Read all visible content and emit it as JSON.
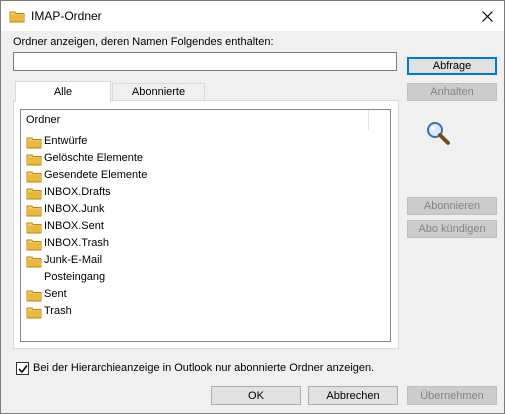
{
  "window": {
    "title": "IMAP-Ordner"
  },
  "filter": {
    "label": "Ordner anzeigen, deren Namen Folgendes enthalten:",
    "value": ""
  },
  "tabs": [
    {
      "label": "Alle",
      "active": true
    },
    {
      "label": "Abonnierte",
      "active": false
    }
  ],
  "list": {
    "header": "Ordner",
    "items": [
      {
        "label": "Entwürfe",
        "icon": "folder-icon"
      },
      {
        "label": "Gelöschte Elemente",
        "icon": "folder-icon"
      },
      {
        "label": "Gesendete Elemente",
        "icon": "folder-icon"
      },
      {
        "label": "INBOX.Drafts",
        "icon": "folder-icon"
      },
      {
        "label": "INBOX.Junk",
        "icon": "folder-icon"
      },
      {
        "label": "INBOX.Sent",
        "icon": "folder-icon"
      },
      {
        "label": "INBOX.Trash",
        "icon": "folder-icon"
      },
      {
        "label": "Junk-E-Mail",
        "icon": "folder-icon"
      },
      {
        "label": "Posteingang",
        "icon": "none"
      },
      {
        "label": "Sent",
        "icon": "folder-icon"
      },
      {
        "label": "Trash",
        "icon": "folder-icon"
      }
    ]
  },
  "buttons": {
    "query": "Abfrage",
    "stop": "Anhalten",
    "subscribe": "Abonnieren",
    "unsubscribe": "Abo kündigen",
    "ok": "OK",
    "cancel": "Abbrechen",
    "apply": "Übernehmen"
  },
  "option": {
    "label": "Bei der Hierarchieanzeige in Outlook nur abonnierte Ordner anzeigen.",
    "checked": true
  },
  "colors": {
    "folder": "#e8b840",
    "accent": "#0078d7"
  }
}
